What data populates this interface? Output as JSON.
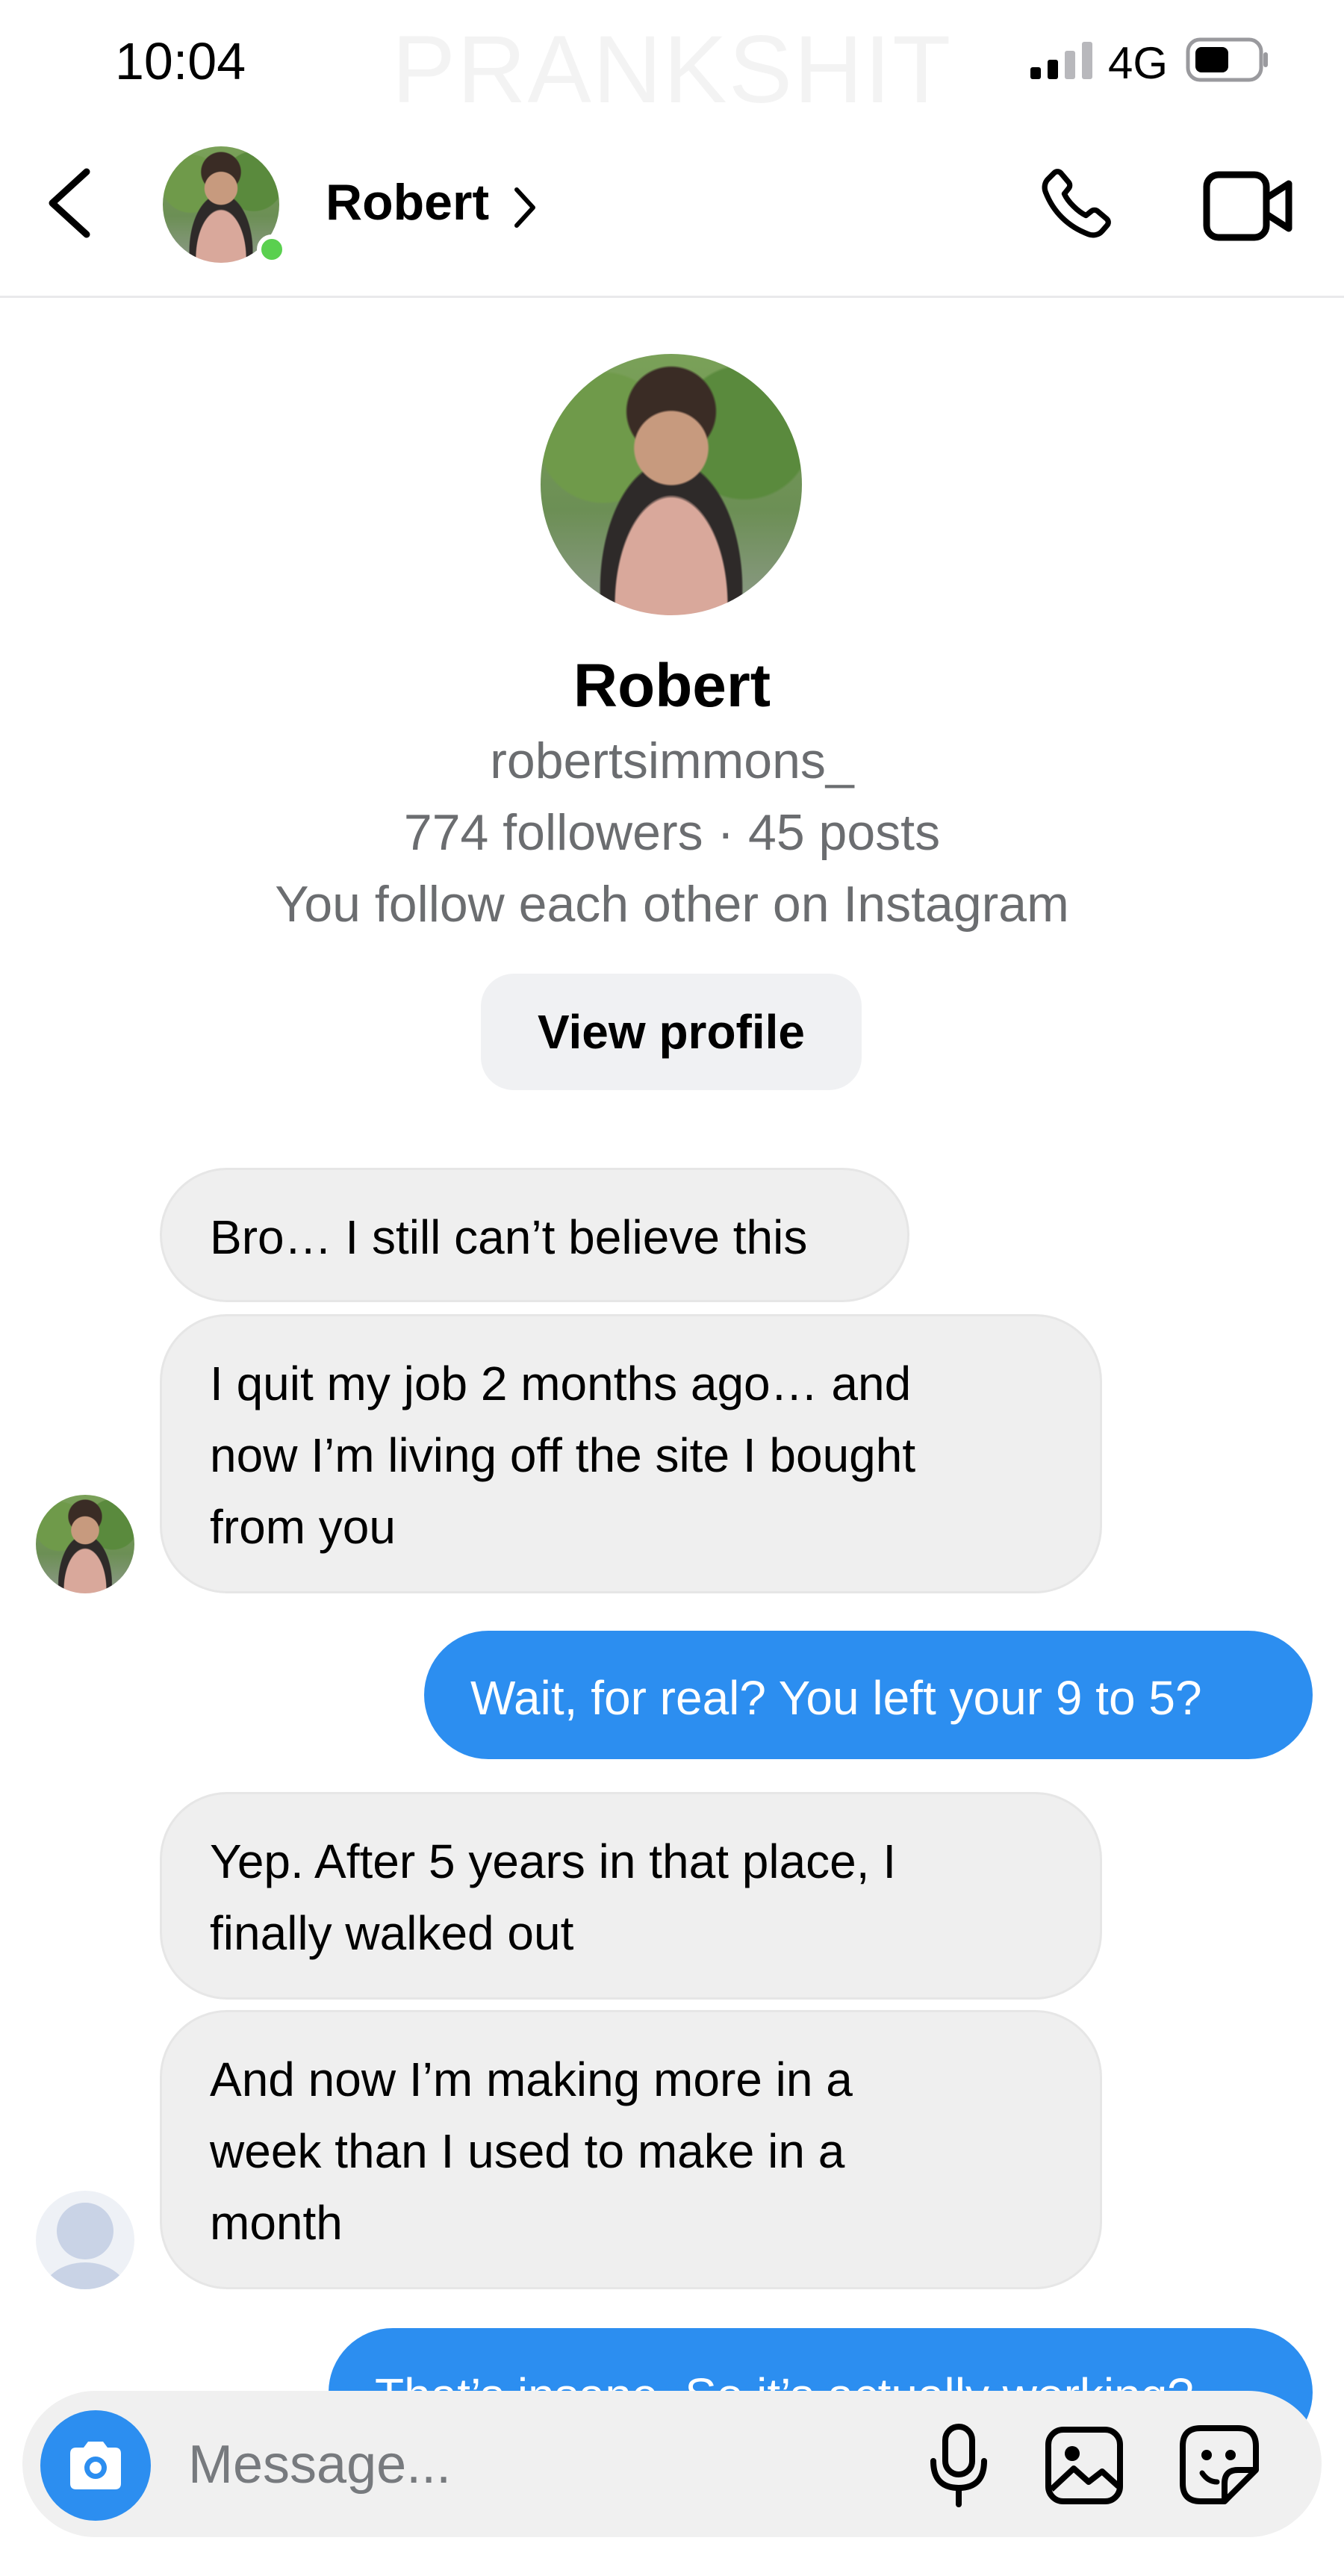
{
  "watermark": "PRANKSHIT",
  "status_bar": {
    "time": "10:04",
    "network": "4G"
  },
  "header": {
    "name": "Robert",
    "chevron": "›"
  },
  "profile": {
    "name": "Robert",
    "handle": "robertsimmons_",
    "stats": "774 followers · 45 posts",
    "mutual": "You follow each other on Instagram",
    "view_profile_label": "View profile"
  },
  "messages": [
    {
      "from": "them",
      "lines": [
        "Bro… I still can’t believe this"
      ]
    },
    {
      "from": "them",
      "lines": [
        "I quit my job 2 months ago… and",
        "now I’m living off the site I bought",
        "from you"
      ]
    },
    {
      "from": "me",
      "lines": [
        "Wait, for real? You left your 9 to 5?"
      ]
    },
    {
      "from": "them",
      "lines": [
        "Yep. After 5 years in that place, I",
        "finally walked out"
      ]
    },
    {
      "from": "them",
      "lines": [
        "And now I’m making more in a",
        "week than I used to make in a",
        "month"
      ]
    },
    {
      "from": "me",
      "lines": [
        "That’s insane. So it’s actually working?"
      ]
    }
  ],
  "composer": {
    "placeholder": "Message..."
  },
  "colors": {
    "accent": "#2c8ef0",
    "incoming_bubble": "#efefef",
    "online": "#5ad04f"
  },
  "icons": [
    "signal-icon",
    "battery-icon",
    "back-icon",
    "phone-icon",
    "video-icon",
    "camera-icon",
    "microphone-icon",
    "gallery-icon",
    "sticker-icon",
    "default-avatar-icon"
  ]
}
